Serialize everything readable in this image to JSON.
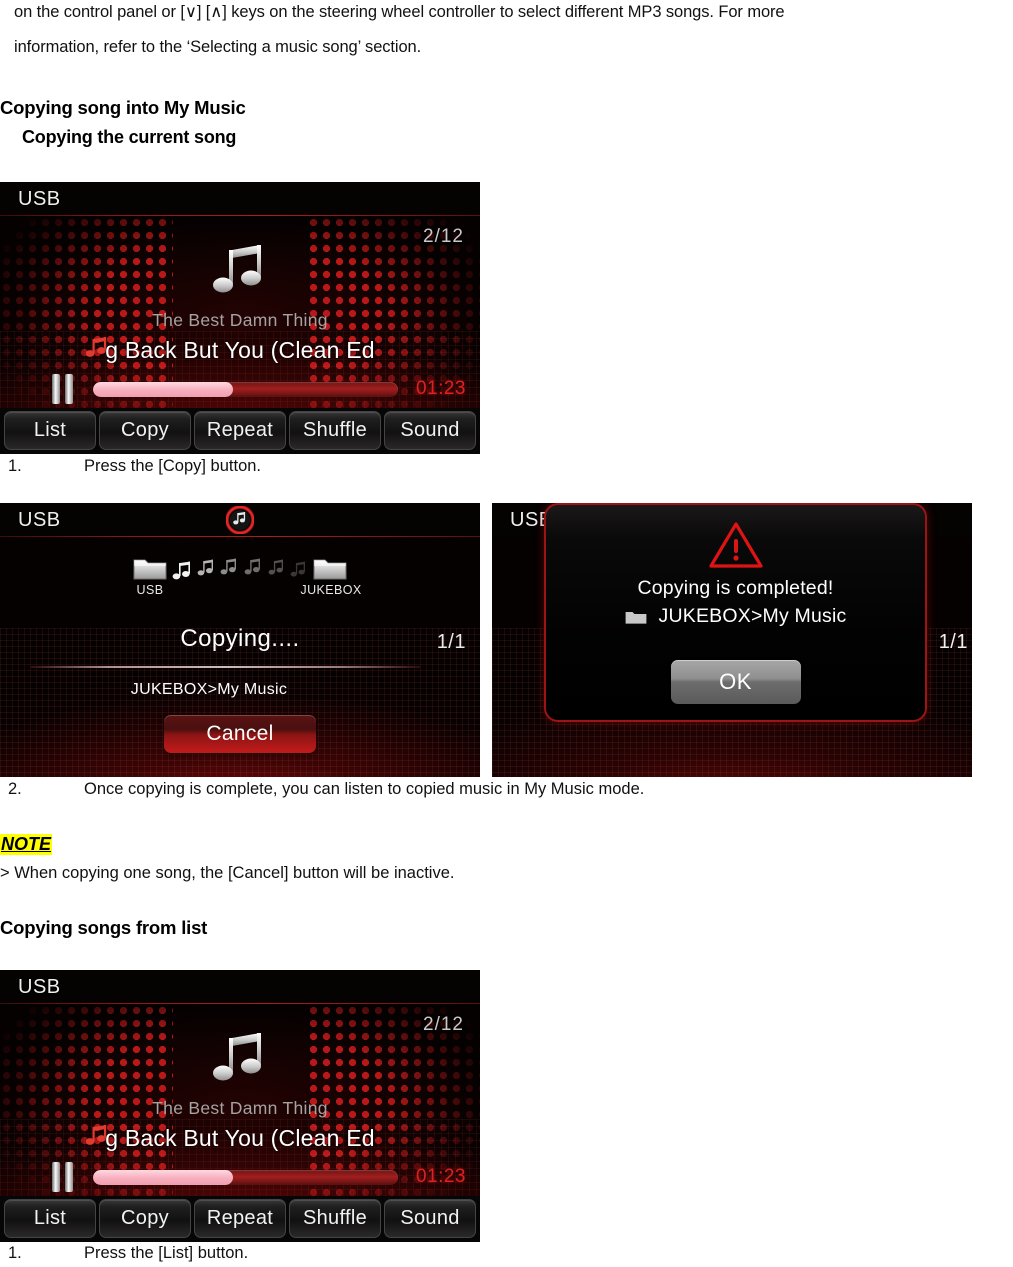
{
  "document": {
    "intro_line_1": "on the control panel or [∨] [∧] keys on the steering wheel controller to select different MP3 songs. For more",
    "intro_line_2": "information, refer to the ‘Selecting a music song’ section.",
    "heading_main": "Copying song into My Music",
    "heading_sub": "Copying the current song",
    "step1_num": "1.",
    "step1_text": "Press the [Copy] button.",
    "step2_num": "2.",
    "step2_text": "Once copying is complete, you can listen to copied music in My Music mode.",
    "note_label": "NOTE",
    "note_text": "> When copying one song, the [Cancel] button will be inactive.",
    "heading_list": "Copying songs from list",
    "step3_num": "1.",
    "step3_text": "Press the [List] button."
  },
  "player": {
    "source_label": "USB",
    "track_counter": "2/12",
    "album": "The Best Damn Thing",
    "title": "g Back But You (Clean Ed",
    "elapsed": "01:23",
    "progress_percent": 46,
    "softkeys": [
      "List",
      "Copy",
      "Repeat",
      "Shuffle",
      "Sound"
    ]
  },
  "copying_screen": {
    "source_label": "USB",
    "from_folder": "USB",
    "to_folder": "JUKEBOX",
    "status": "Copying....",
    "page_counter": "1/1",
    "destination_path": "JUKEBOX>My Music",
    "cancel_label": "Cancel"
  },
  "completed_screen": {
    "source_label": "USB",
    "message": "Copying is completed!",
    "destination_path": "JUKEBOX>My Music",
    "ok_label": "OK",
    "page_counter": "1/1"
  },
  "colors": {
    "accent_red": "#c41b1b",
    "time_red": "#e02020",
    "highlight_yellow": "#ffff00",
    "screen_black": "#050202"
  }
}
